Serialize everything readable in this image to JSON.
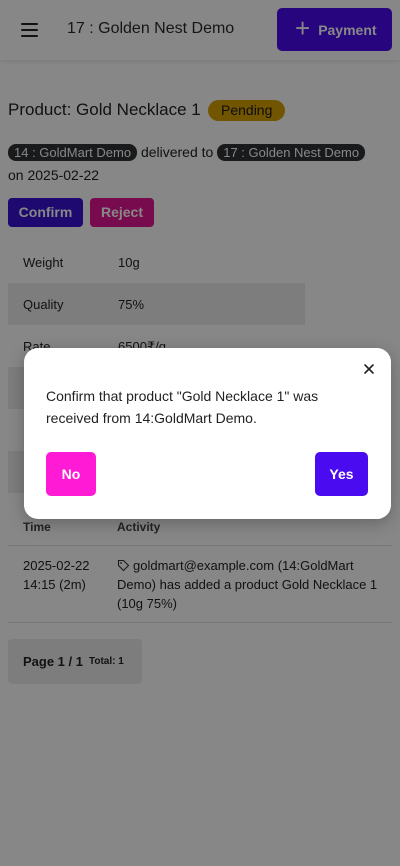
{
  "header": {
    "title": "17 : Golden Nest Demo",
    "payment_label": "Payment",
    "accent_color": "#4a0bf0"
  },
  "product": {
    "title": "Product: Gold Necklace 1",
    "status": "Pending",
    "from_party": "14 : GoldMart Demo",
    "delivered_text": "delivered to",
    "to_party": "17 : Golden Nest Demo",
    "date_text": "on 2025-02-22"
  },
  "actions": {
    "confirm_label": "Confirm",
    "reject_label": "Reject"
  },
  "details": [
    {
      "key": "Weight",
      "value": "10g"
    },
    {
      "key": "Quality",
      "value": "75%"
    },
    {
      "key": "Rate",
      "value": "6500₹/g"
    }
  ],
  "activity": {
    "headers": {
      "time": "Time",
      "activity": "Activity"
    },
    "rows": [
      {
        "time": "2025-02-22 14:15 (2m)",
        "text": "goldmart@example.com (14:GoldMart Demo) has added a product Gold Necklace 1 (10g 75%)"
      }
    ]
  },
  "pager": {
    "label": "Page 1 / 1",
    "total": "Total: 1"
  },
  "modal": {
    "message": "Confirm that product \"Gold Necklace 1\" was received from 14:GoldMart Demo.",
    "no_label": "No",
    "yes_label": "Yes"
  },
  "colors": {
    "pending_badge": "#d8a000",
    "reject": "#e01694",
    "no_button": "#ff1ad6",
    "party_pill": "#2f3136"
  }
}
